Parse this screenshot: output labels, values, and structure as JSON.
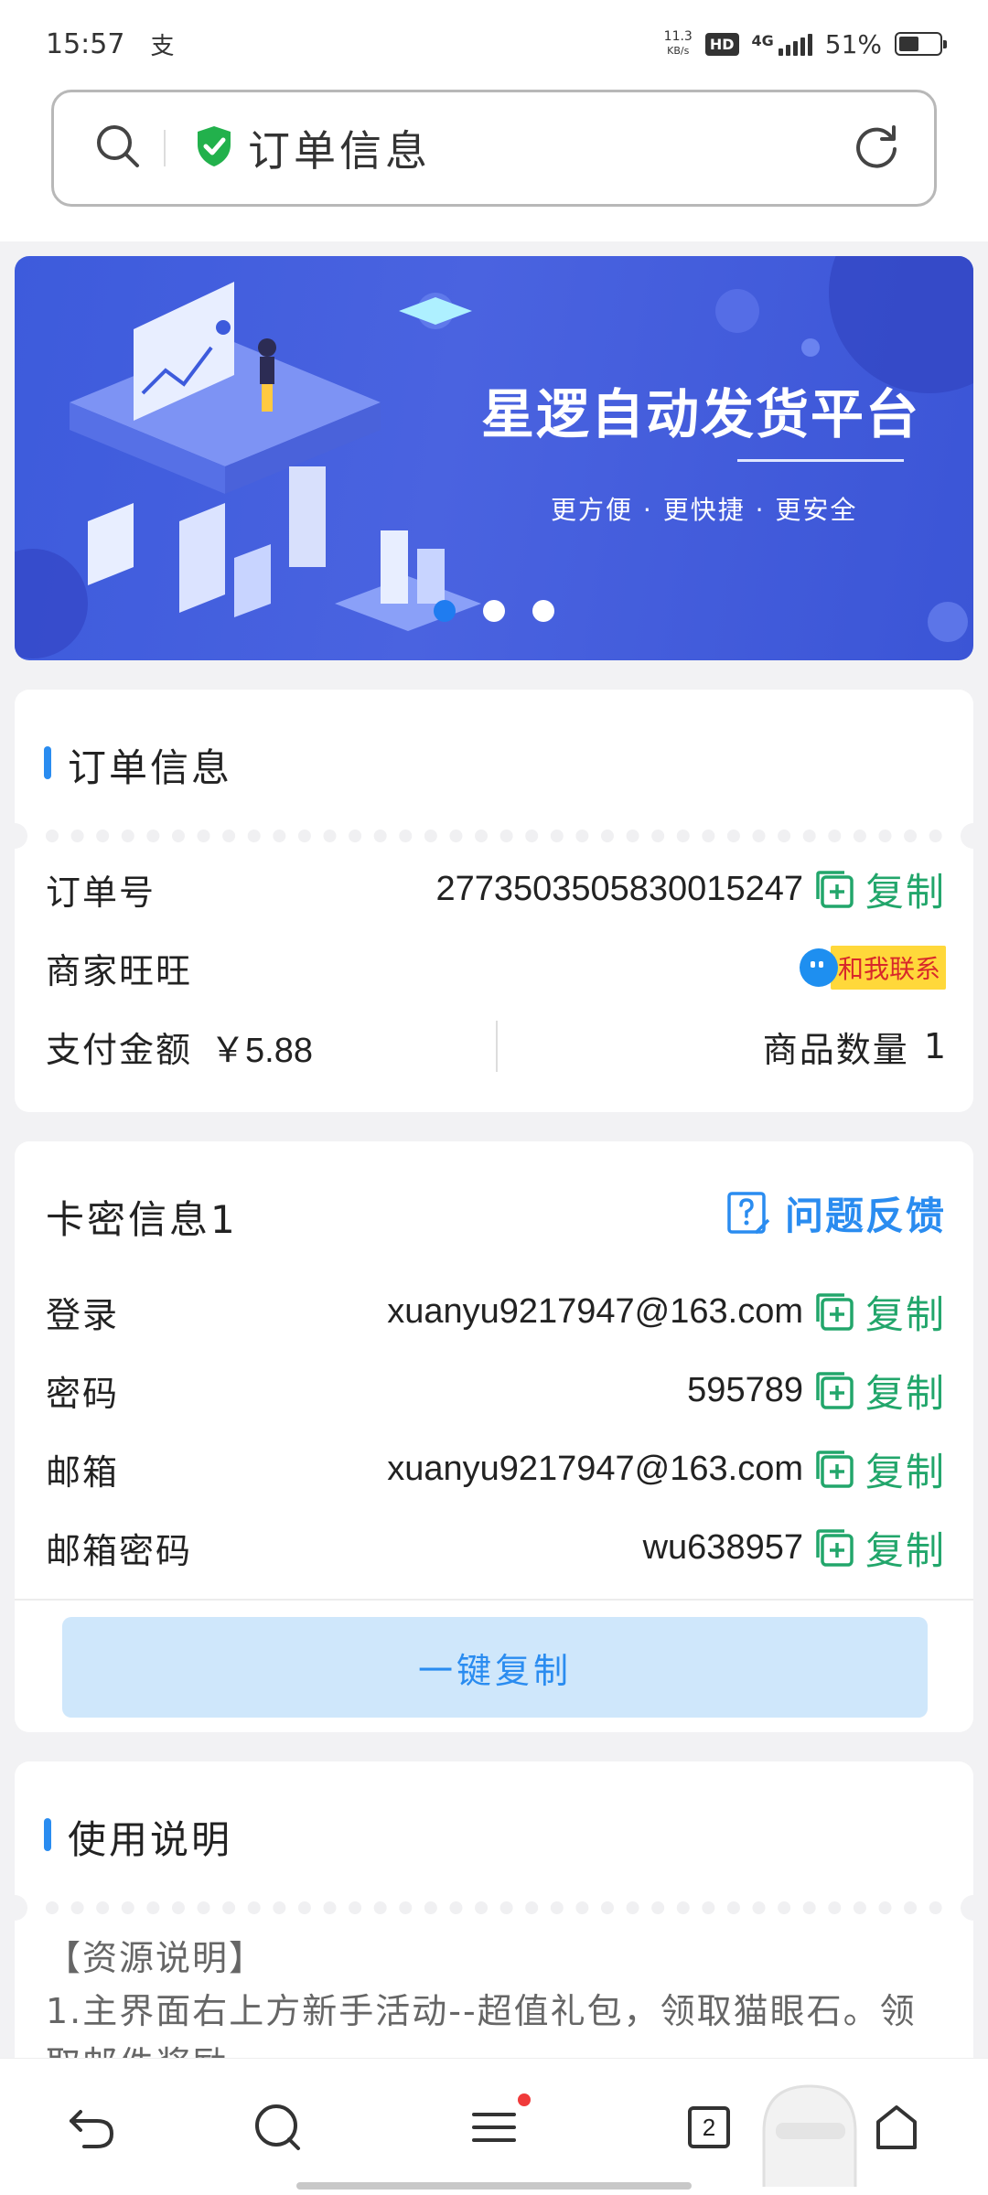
{
  "status_bar": {
    "time": "15:57",
    "notification_glyph": "支",
    "net_speed_value": "11.3",
    "net_speed_unit": "KB/s",
    "hd_label": "HD",
    "signal_label": "4G",
    "battery_text": "51%",
    "battery_level": 0.51
  },
  "url_bar": {
    "title": "订单信息",
    "icons": [
      "search-icon",
      "shield-check-icon",
      "refresh-icon"
    ],
    "shield_color": "#22b14c"
  },
  "banner": {
    "title": "星逻自动发货平台",
    "subtitle": "更方便 · 更快捷 · 更安全",
    "slide_count": 3,
    "active_slide": 0
  },
  "order_info": {
    "section_title": "订单信息",
    "order_no_label": "订单号",
    "order_no_value": "2773503505830015247",
    "copy_label": "复制",
    "merchant_label": "商家旺旺",
    "contact_label": "和我联系",
    "pay_label": "支付金额",
    "pay_value": "￥5.88",
    "qty_label": "商品数量",
    "qty_value": "1"
  },
  "card_info": {
    "section_title": "卡密信息1",
    "feedback_label": "问题反馈",
    "rows": [
      {
        "label": "登录",
        "value": "xuanyu9217947@163.com",
        "copy": "复制"
      },
      {
        "label": "密码",
        "value": "595789",
        "copy": "复制"
      },
      {
        "label": "邮箱",
        "value": "xuanyu9217947@163.com",
        "copy": "复制"
      },
      {
        "label": "邮箱密码",
        "value": "wu638957",
        "copy": "复制"
      }
    ],
    "copy_all_label": "一键复制"
  },
  "usage": {
    "section_title": "使用说明",
    "lines": [
      "【资源说明】",
      "1.主界面右上方新手活动--超值礼包，领取猫眼石。领",
      "取邮件奖励"
    ]
  },
  "bottom_nav": {
    "tab_count": "2",
    "icons": [
      "back-icon",
      "search-icon",
      "menu-icon",
      "tabs-icon",
      "home-icon"
    ],
    "menu_badge_color": "#f03a3a"
  },
  "colors": {
    "accent_blue": "#2a8cf0",
    "copy_green": "#22a66b",
    "banner_blue": "#4a63e0"
  }
}
